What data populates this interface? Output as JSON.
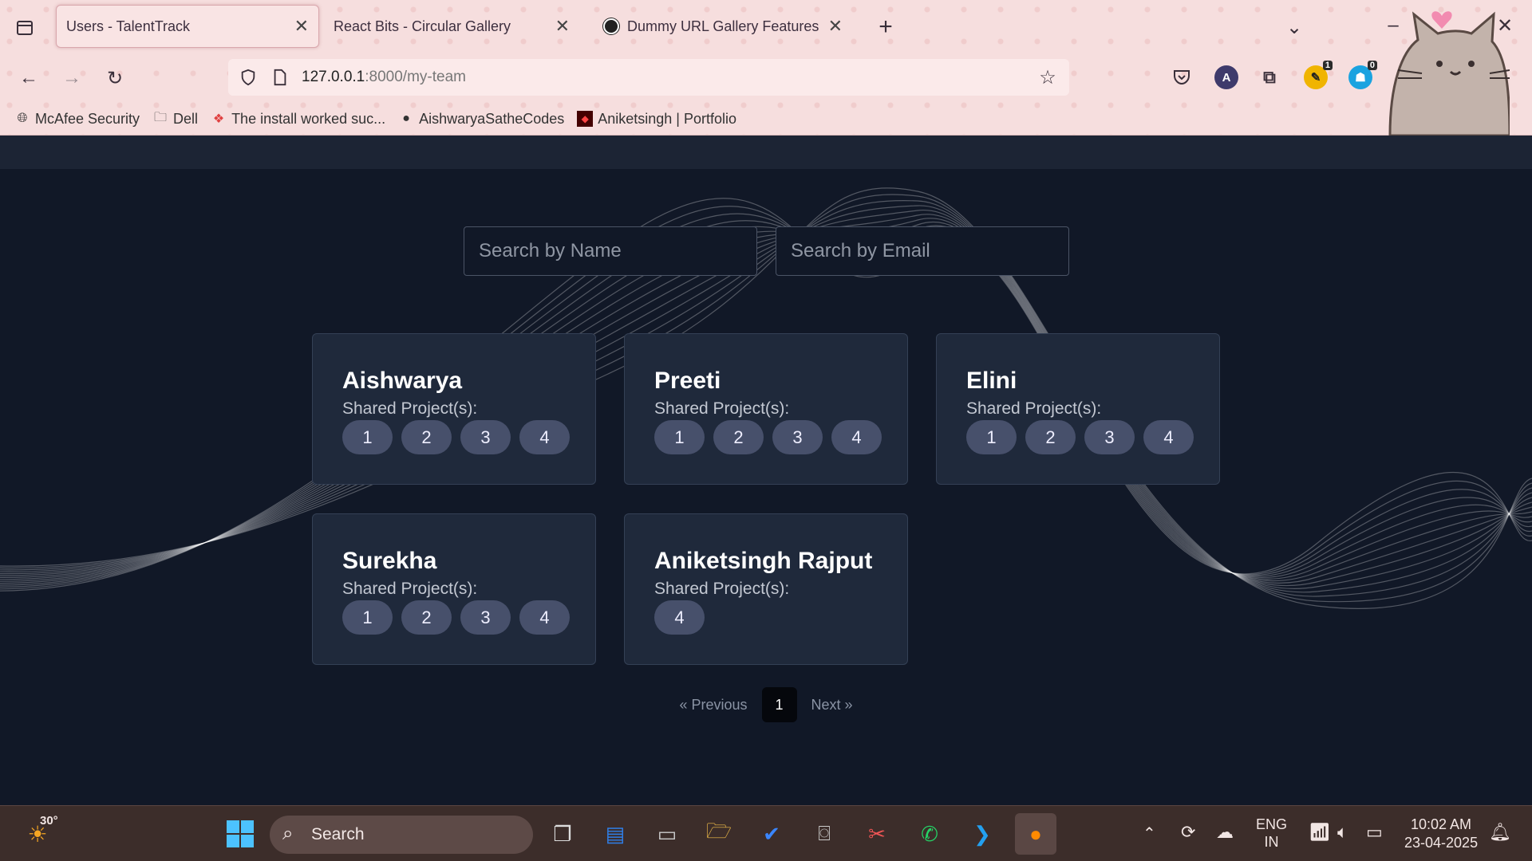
{
  "browser": {
    "tabs": [
      {
        "title": "Users - TalentTrack",
        "active": true
      },
      {
        "title": "React Bits - Circular Gallery",
        "active": false
      },
      {
        "title": "Dummy URL Gallery Features",
        "active": false
      }
    ],
    "new_tab_icon": "+",
    "url_host": "127.0.0.1",
    "url_rest": ":8000/my-team",
    "bookmarks": [
      "McAfee Security",
      "Dell",
      "The install worked suc...",
      "AishwaryaSatheCodes",
      "Aniketsingh | Portfolio"
    ],
    "extension_badges": {
      "ext1": "1",
      "ext2": "0"
    },
    "profile_letter": "A"
  },
  "page": {
    "search_name_placeholder": "Search by Name",
    "search_email_placeholder": "Search by Email",
    "shared_label": "Shared Project(s):",
    "members": [
      {
        "name": "Aishwarya",
        "projects": [
          "1",
          "2",
          "3",
          "4"
        ]
      },
      {
        "name": "Preeti",
        "projects": [
          "1",
          "2",
          "3",
          "4"
        ]
      },
      {
        "name": "Elini",
        "projects": [
          "1",
          "2",
          "3",
          "4"
        ]
      },
      {
        "name": "Surekha",
        "projects": [
          "1",
          "2",
          "3",
          "4"
        ]
      },
      {
        "name": "Aniketsingh Rajput",
        "projects": [
          "4"
        ]
      }
    ],
    "pagination": {
      "prev": "« Previous",
      "current": "1",
      "next": "Next »"
    }
  },
  "taskbar": {
    "weather_temp": "30°",
    "search_label": "Search",
    "lang": "ENG",
    "region": "IN",
    "time": "10:02 AM",
    "date": "23-04-2025"
  }
}
